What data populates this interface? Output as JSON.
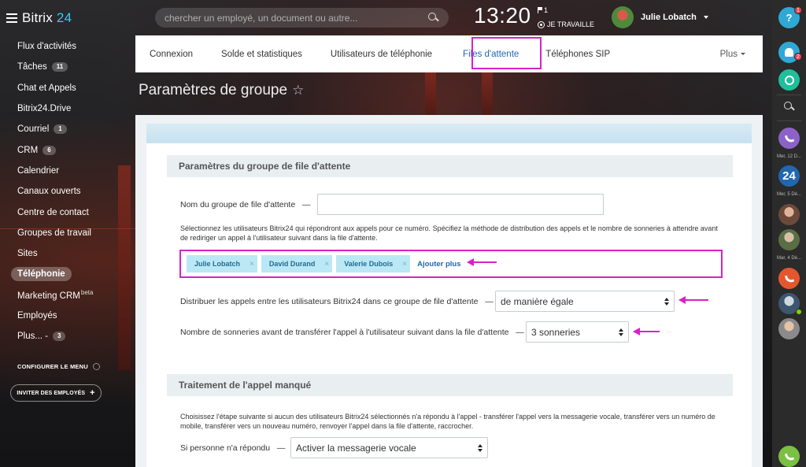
{
  "brand": {
    "name": "Bitrix",
    "suffix": "24"
  },
  "search": {
    "placeholder": "chercher un employé, un document ou autre..."
  },
  "clock": {
    "time": "13:20",
    "flag_count": "1",
    "work_status": "JE TRAVAILLE"
  },
  "user": {
    "name": "Julie Lobatch"
  },
  "sidebar": {
    "items": [
      {
        "label": "Flux d'activités",
        "badge": ""
      },
      {
        "label": "Tâches",
        "badge": "11"
      },
      {
        "label": "Chat et Appels",
        "badge": ""
      },
      {
        "label": "Bitrix24.Drive",
        "badge": ""
      },
      {
        "label": "Courriel",
        "badge": "1"
      },
      {
        "label": "CRM",
        "badge": "6"
      },
      {
        "label": "Calendrier",
        "badge": ""
      },
      {
        "label": "Canaux ouverts",
        "badge": ""
      },
      {
        "label": "Centre de contact",
        "badge": ""
      },
      {
        "label": "Groupes de travail",
        "badge": ""
      },
      {
        "label": "Sites",
        "badge": ""
      },
      {
        "label": "Téléphonie",
        "badge": ""
      },
      {
        "label": "Marketing CRM",
        "badge": "",
        "sup": "beta"
      },
      {
        "label": "Employés",
        "badge": ""
      },
      {
        "label": "Plus... -",
        "badge": "3"
      }
    ],
    "config_label": "CONFIGURER LE MENU",
    "invite_label": "INVITER DES EMPLOYÉS",
    "invite_plus": "+"
  },
  "tabs": [
    {
      "label": "Connexion"
    },
    {
      "label": "Solde et statistiques"
    },
    {
      "label": "Utilisateurs de téléphonie"
    },
    {
      "label": "Files d'attente"
    },
    {
      "label": "Téléphones SIP"
    }
  ],
  "tab_more": "Plus",
  "page": {
    "title": "Paramètres de groupe",
    "star": "☆"
  },
  "form": {
    "section1_title": "Paramètres du groupe de file d'attente",
    "group_name_label": "Nom du groupe de file d'attente",
    "dash": "—",
    "group_name_value": "",
    "users_hint": "Sélectionnez les utilisateurs Bitrix24 qui répondront aux appels pour ce numéro. Spécifiez la méthode de distribution des appels et le nombre de sonneries à attendre avant de rediriger un appel à l'utilisateur suivant dans la file d'attente.",
    "users": [
      "Julie Lobatch",
      "David Durand",
      "Valerie Dubois"
    ],
    "chip_close": "×",
    "add_more": "Ajouter plus",
    "distribute_label": "Distribuer les appels entre les utilisateurs Bitrix24 dans ce groupe de file d'attente",
    "distribute_value": "de manière égale",
    "rings_label": "Nombre de sonneries avant de transférer l'appel à l'utilisateur suivant dans la file d'attente",
    "rings_value": "3 sonneries",
    "section2_title": "Traitement de l'appel manqué",
    "missed_hint": "Choisissez l'étape suivante si aucun des utilisateurs Bitrix24 sélectionnés n'a répondu à l'appel - transférer l'appel vers la messagerie vocale, transférer vers un numéro de mobile, transférer vers un nouveau numéro, renvoyer l'appel dans la file d'attente, raccrocher.",
    "no_answer_label": "Si personne n'a répondu",
    "no_answer_value": "Activer la messagerie vocale"
  },
  "rail": {
    "help": "?",
    "help_badge": "1",
    "notif_badge": "2",
    "date1": "Mer, 12 D...",
    "date2": "Mer, 5 Dé...",
    "date3": "Mar, 4 Dé...",
    "b24": "24"
  },
  "colors": {
    "accent": "#2067b0",
    "highlight": "#d821c8",
    "chip_bg": "#bce8f5",
    "brand_blue": "#3bc8f5"
  }
}
